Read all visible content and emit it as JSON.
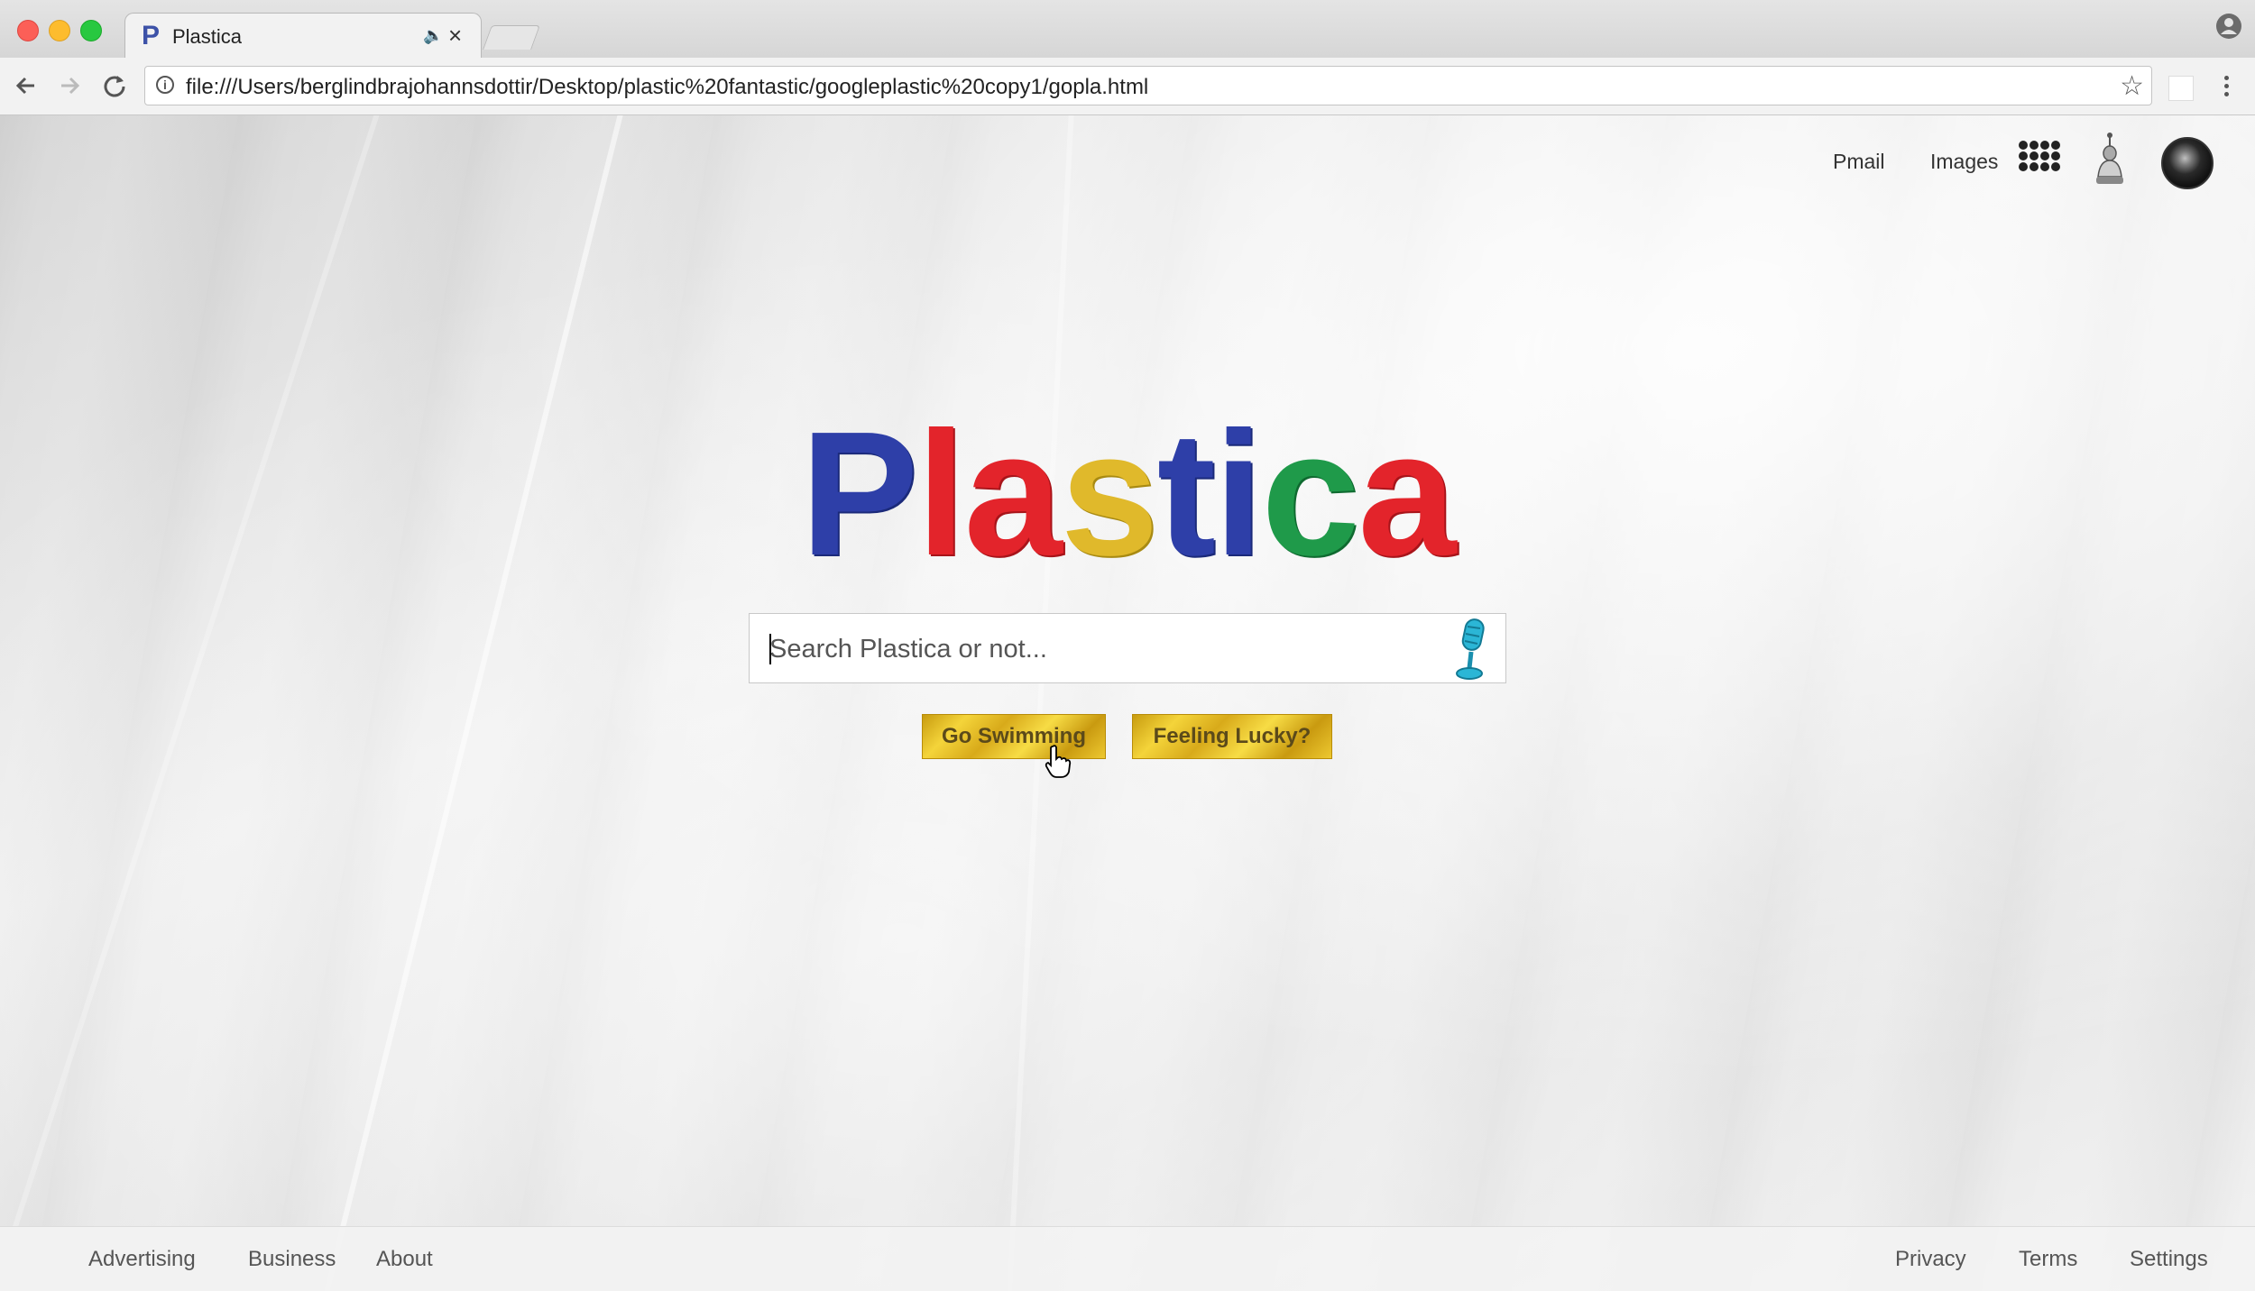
{
  "browser": {
    "tab_title": "Plastica",
    "tab_favicon": "P",
    "url": "file:///Users/berglindbrajohannsdottir/Desktop/plastic%20fantastic/googleplastic%20copy1/gopla.html"
  },
  "header": {
    "links": [
      {
        "label": "Pmail"
      },
      {
        "label": "Images"
      }
    ],
    "icons": [
      "apps-grid-icon",
      "notifications-icon",
      "account-avatar"
    ]
  },
  "logo": {
    "letters": [
      {
        "char": "P",
        "color": "#2e3fa8"
      },
      {
        "char": "l",
        "color": "#e3242b"
      },
      {
        "char": "a",
        "color": "#e3242b"
      },
      {
        "char": "s",
        "color": "#e0b92b"
      },
      {
        "char": "t",
        "color": "#2e3fa8"
      },
      {
        "char": "i",
        "color": "#2e3fa8"
      },
      {
        "char": "c",
        "color": "#1f9a4a"
      },
      {
        "char": "a",
        "color": "#e3242b"
      }
    ]
  },
  "search": {
    "placeholder": "Search Plastica or not...",
    "value": "",
    "mic_icon": "microphone-icon"
  },
  "buttons": {
    "primary": "Go Swimming",
    "secondary": "Feeling Lucky?"
  },
  "footer": {
    "left": [
      "Advertising",
      "Business",
      "About"
    ],
    "right": [
      "Privacy",
      "Terms",
      "Settings"
    ]
  },
  "colors": {
    "button_gold": "#e6c02a",
    "footer_bg": "#f2f2f2"
  }
}
